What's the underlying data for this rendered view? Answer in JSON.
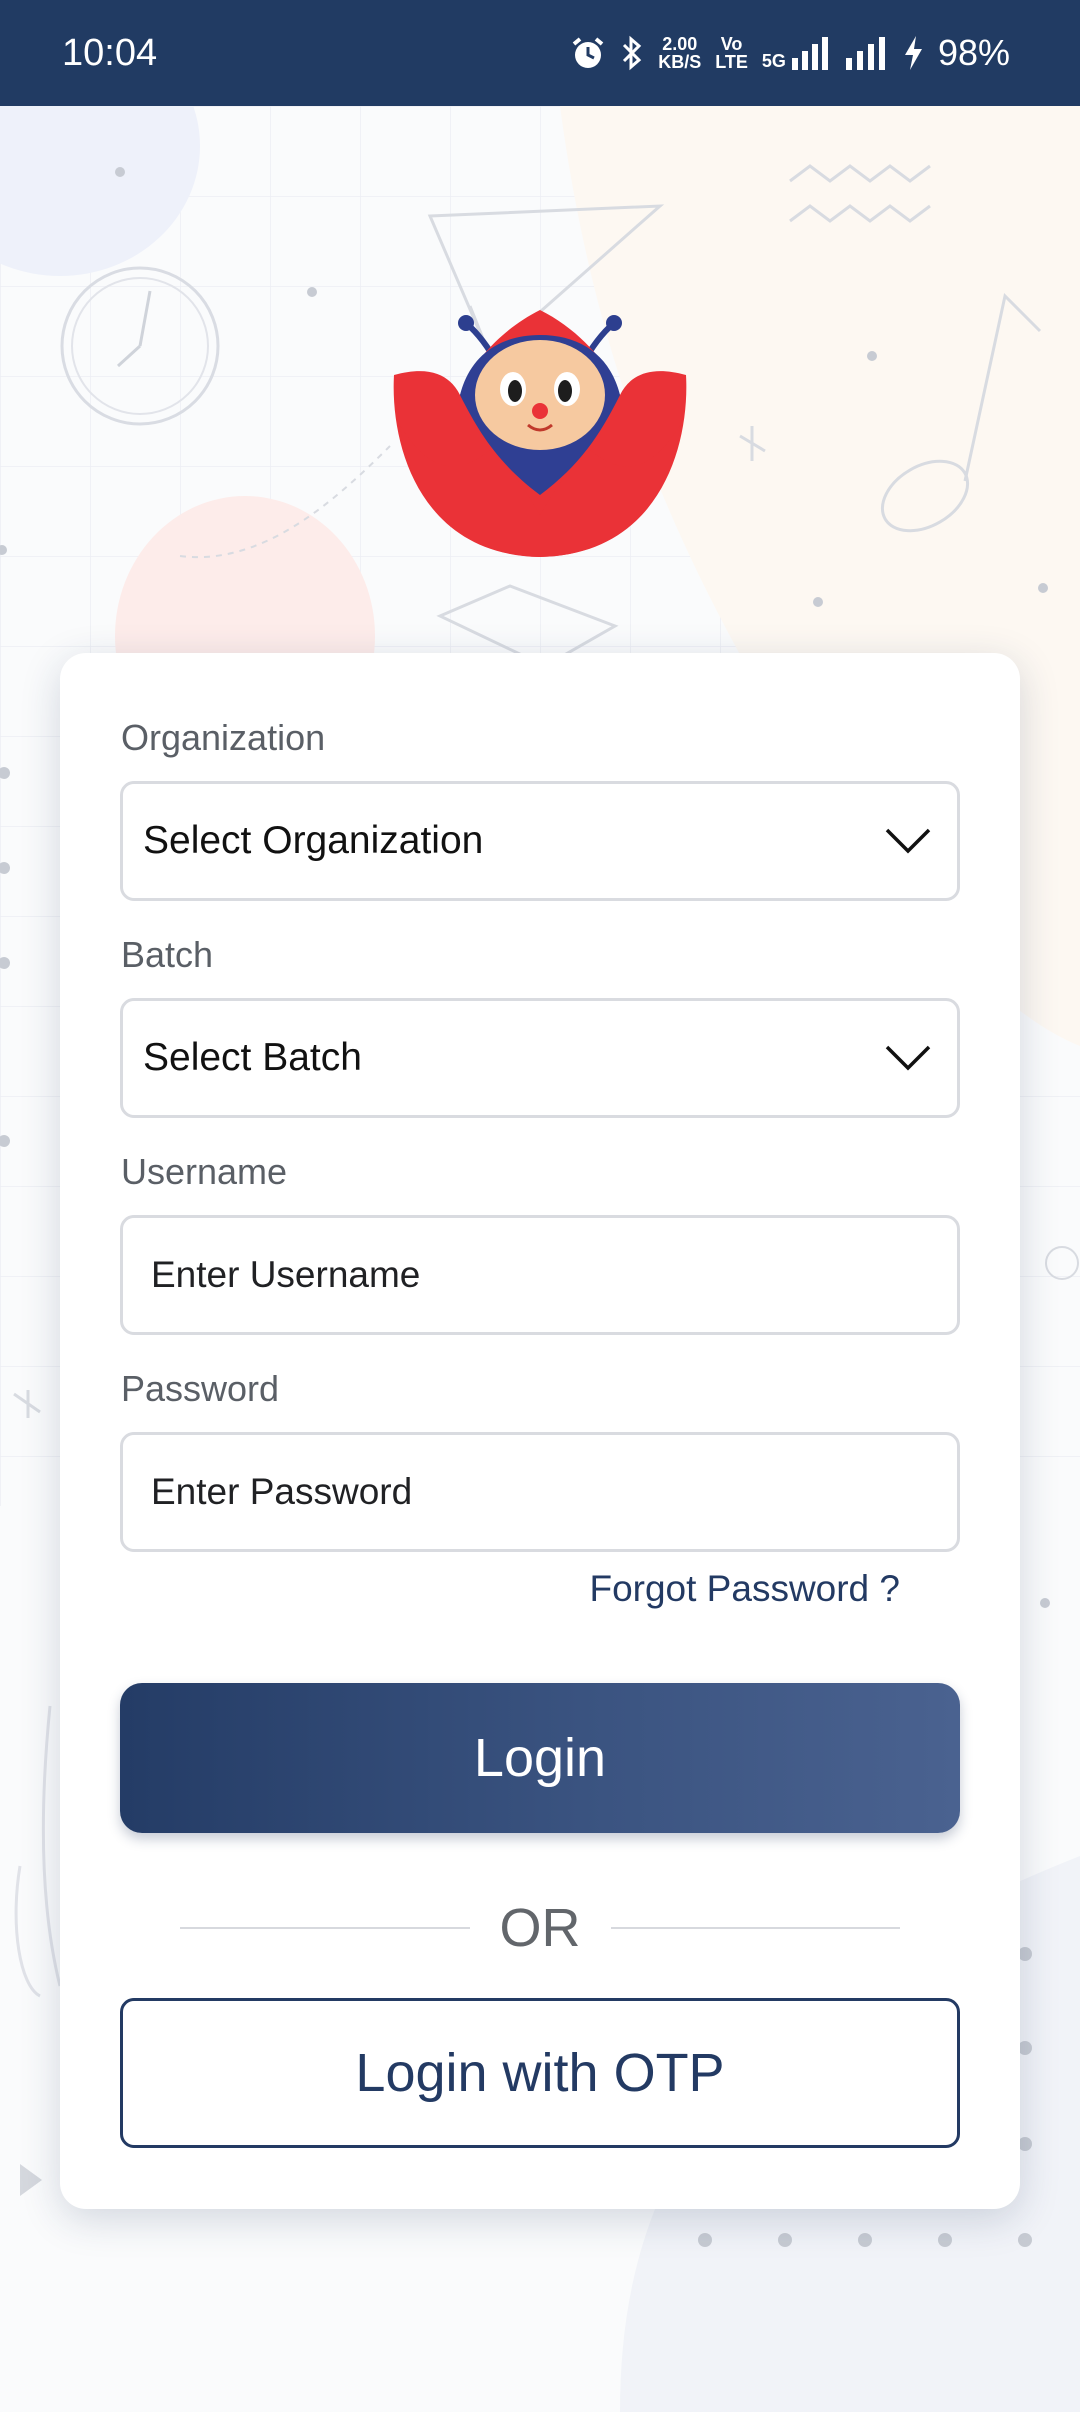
{
  "status_bar": {
    "time": "10:04",
    "speed_value": "2.00",
    "speed_unit": "KB/S",
    "volte_top": "Vo",
    "volte_bottom": "LTE",
    "network": "5G",
    "battery": "98%"
  },
  "form": {
    "organization_label": "Organization",
    "organization_value": "Select Organization",
    "batch_label": "Batch",
    "batch_value": "Select Batch",
    "username_label": "Username",
    "username_placeholder": "Enter Username",
    "password_label": "Password",
    "password_placeholder": "Enter Password",
    "forgot_password": "Forgot Password ?",
    "login_button": "Login",
    "divider_text": "OR",
    "otp_button": "Login with OTP"
  },
  "colors": {
    "primary": "#233a63",
    "brand_red": "#ea3237",
    "status_bar": "#213b63"
  },
  "icons": [
    "alarm-icon",
    "bluetooth-icon",
    "signal-icon",
    "charging-icon",
    "chevron-down-icon"
  ]
}
